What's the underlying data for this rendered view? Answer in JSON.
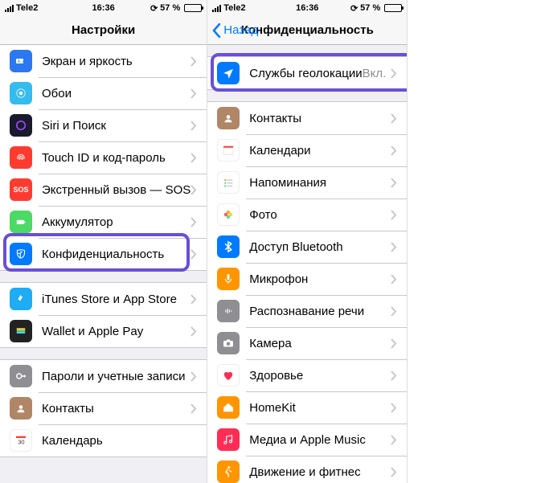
{
  "status": {
    "carrier": "Tele2",
    "time": "16:36",
    "battery_pct": "57 %"
  },
  "left": {
    "title": "Настройки",
    "rows": {
      "display": "Экран и яркость",
      "wallpaper": "Обои",
      "siri": "Siri и Поиск",
      "touchid": "Touch ID и код-пароль",
      "sos": "Экстренный вызов — SOS",
      "battery": "Аккумулятор",
      "privacy": "Конфиденциальность",
      "itunes": "iTunes Store и App Store",
      "wallet": "Wallet и Apple Pay",
      "passwords": "Пароли и учетные записи",
      "contacts": "Контакты",
      "calendar": "Календарь"
    }
  },
  "right": {
    "back": "Назад",
    "title": "Конфиденциальность",
    "rows": {
      "location": "Службы геолокации",
      "location_value": "Вкл.",
      "contacts": "Контакты",
      "calendars": "Календари",
      "reminders": "Напоминания",
      "photos": "Фото",
      "bluetooth": "Доступ Bluetooth",
      "microphone": "Микрофон",
      "speech": "Распознавание речи",
      "camera": "Камера",
      "health": "Здоровье",
      "homekit": "HomeKit",
      "media": "Медиа и Apple Music",
      "motion": "Движение и фитнес"
    }
  }
}
